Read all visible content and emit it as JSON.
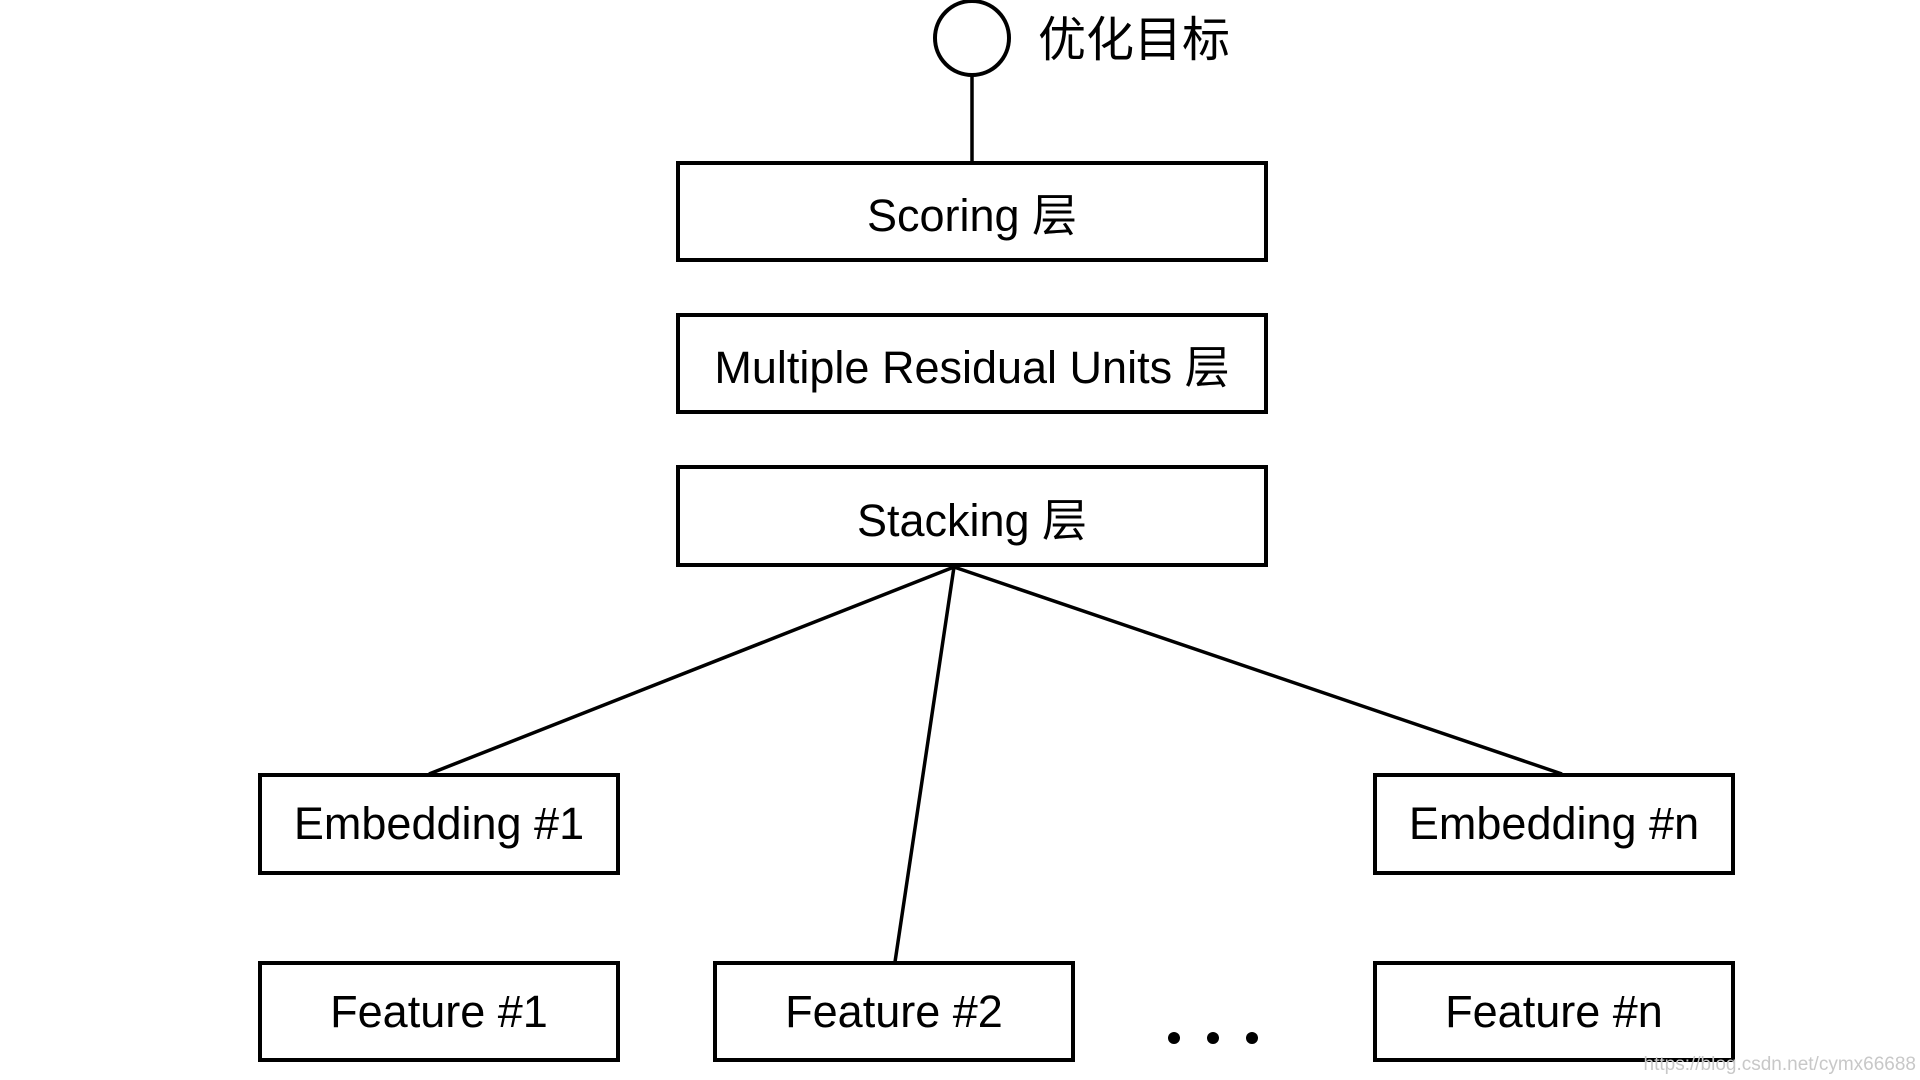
{
  "diagram": {
    "goal": {
      "label": "优化目标",
      "icon": "circle-node-icon"
    },
    "layers": [
      {
        "id": "scoring",
        "label": "Scoring 层"
      },
      {
        "id": "mru",
        "label": "Multiple Residual Units 层"
      },
      {
        "id": "stacking",
        "label": "Stacking 层"
      }
    ],
    "embeddings": [
      {
        "id": "emb1",
        "label": "Embedding #1"
      },
      {
        "id": "embn",
        "label": "Embedding #n"
      }
    ],
    "features": [
      {
        "id": "f1",
        "label": "Feature #1"
      },
      {
        "id": "f2",
        "label": "Feature #2"
      },
      {
        "id": "fn",
        "label": "Feature #n"
      }
    ],
    "ellipsis": "…",
    "edges": [
      {
        "from": "goal",
        "to": "scoring"
      },
      {
        "from": "stacking",
        "to": "emb1"
      },
      {
        "from": "stacking",
        "to": "f2"
      },
      {
        "from": "stacking",
        "to": "embn"
      }
    ]
  },
  "watermark": "https://blog.csdn.net/cymx66688"
}
